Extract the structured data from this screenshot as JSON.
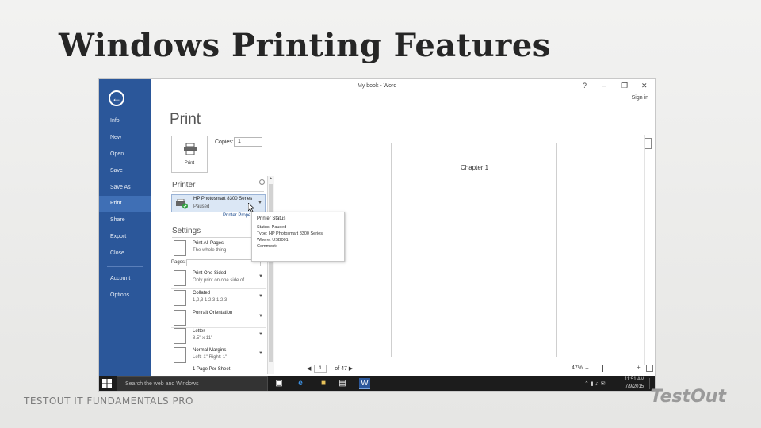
{
  "slide": {
    "title": "Windows Printing Features",
    "footer_left": "TESTOUT IT FUNDAMENTALS PRO",
    "footer_logo": "TestOut"
  },
  "app": {
    "title": "My book - Word",
    "help": "?",
    "minimize": "‒",
    "restore": "❐",
    "close": "✕",
    "sign_in": "Sign in",
    "accent_color": "#2b579a"
  },
  "backstage": {
    "back_icon": "arrow-left-icon",
    "items": [
      {
        "label": "Info",
        "active": false
      },
      {
        "label": "New",
        "active": false
      },
      {
        "label": "Open",
        "active": false
      },
      {
        "label": "Save",
        "active": false
      },
      {
        "label": "Save As",
        "active": false
      },
      {
        "label": "Print",
        "active": true
      },
      {
        "label": "Share",
        "active": false
      },
      {
        "label": "Export",
        "active": false
      },
      {
        "label": "Close",
        "active": false
      },
      {
        "label": "Account",
        "active": false
      },
      {
        "label": "Options",
        "active": false
      }
    ]
  },
  "print": {
    "heading": "Print",
    "print_button_label": "Print",
    "copies_label": "Copies:",
    "copies_value": "1",
    "printer_heading": "Printer",
    "printer_name": "HP Photosmart 8300 Series",
    "printer_status": "Paused",
    "printer_properties": "Printer Prope",
    "settings_heading": "Settings",
    "pages_label": "Pages:",
    "settings": [
      {
        "line1": "Print All Pages",
        "line2": "The whole thing"
      },
      {
        "line1": "Print One Sided",
        "line2": "Only print on one side of..."
      },
      {
        "line1": "Collated",
        "line2": "1,2,3   1,2,3   1,2,3"
      },
      {
        "line1": "Portrait Orientation",
        "line2": ""
      },
      {
        "line1": "Letter",
        "line2": "8.5\" x 11\""
      },
      {
        "line1": "Normal Margins",
        "line2": "Left: 1\"  Right: 1\""
      },
      {
        "line1": "1 Page Per Sheet",
        "line2": ""
      }
    ]
  },
  "tooltip": {
    "title": "Printer Status",
    "lines": [
      "Status: Paused",
      "Type: HP Photosmart 8300 Series",
      "Where: USB001",
      "Comment:"
    ]
  },
  "preview": {
    "page_text": "Chapter 1",
    "page_current": "1",
    "page_total": "of 47",
    "zoom": "47%"
  },
  "taskbar": {
    "search_placeholder": "Search the web and Windows",
    "icons": [
      "task-view-icon",
      "edge-icon",
      "file-explorer-icon",
      "store-icon",
      "word-icon"
    ],
    "time": "11:51 AM",
    "date": "7/9/2015"
  }
}
